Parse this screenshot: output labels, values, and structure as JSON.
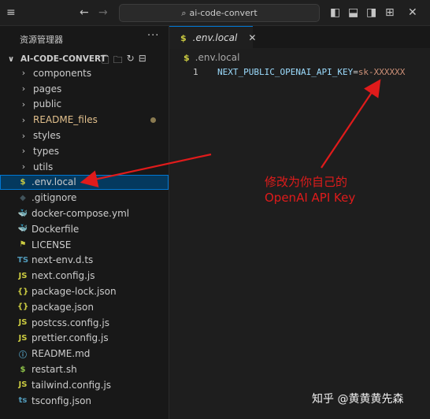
{
  "titlebar": {
    "search_text": "ai-code-convert",
    "back_icon": "arrow-left",
    "forward_icon": "arrow-right"
  },
  "explorer": {
    "header": "资源管理器",
    "more": "···",
    "root": "AI-CODE-CONVERT",
    "items": [
      {
        "label": "components",
        "type": "folder"
      },
      {
        "label": "pages",
        "type": "folder"
      },
      {
        "label": "public",
        "type": "folder"
      },
      {
        "label": "README_files",
        "type": "folder",
        "modified": true
      },
      {
        "label": "styles",
        "type": "folder"
      },
      {
        "label": "types",
        "type": "folder"
      },
      {
        "label": "utils",
        "type": "folder"
      },
      {
        "label": ".env.local",
        "type": "file",
        "icon": "$",
        "icon_color": "#cbcb41",
        "selected": true
      },
      {
        "label": ".gitignore",
        "type": "file",
        "icon": "◆",
        "icon_color": "#41535b"
      },
      {
        "label": "docker-compose.yml",
        "type": "file",
        "icon": "🐳",
        "icon_color": "#e06c75"
      },
      {
        "label": "Dockerfile",
        "type": "file",
        "icon": "🐳",
        "icon_color": "#519aba"
      },
      {
        "label": "LICENSE",
        "type": "file",
        "icon": "⚑",
        "icon_color": "#cbcb41"
      },
      {
        "label": "next-env.d.ts",
        "type": "file",
        "icon": "TS",
        "icon_color": "#519aba"
      },
      {
        "label": "next.config.js",
        "type": "file",
        "icon": "JS",
        "icon_color": "#cbcb41"
      },
      {
        "label": "package-lock.json",
        "type": "file",
        "icon": "{}",
        "icon_color": "#cbcb41"
      },
      {
        "label": "package.json",
        "type": "file",
        "icon": "{}",
        "icon_color": "#cbcb41"
      },
      {
        "label": "postcss.config.js",
        "type": "file",
        "icon": "JS",
        "icon_color": "#cbcb41"
      },
      {
        "label": "prettier.config.js",
        "type": "file",
        "icon": "JS",
        "icon_color": "#cbcb41"
      },
      {
        "label": "README.md",
        "type": "file",
        "icon": "ⓘ",
        "icon_color": "#519aba"
      },
      {
        "label": "restart.sh",
        "type": "file",
        "icon": "$",
        "icon_color": "#8dc149"
      },
      {
        "label": "tailwind.config.js",
        "type": "file",
        "icon": "JS",
        "icon_color": "#cbcb41"
      },
      {
        "label": "tsconfig.json",
        "type": "file",
        "icon": "ts",
        "icon_color": "#519aba"
      }
    ]
  },
  "editor": {
    "tab_label": ".env.local",
    "tab_icon": "$",
    "breadcrumb": ".env.local",
    "line_number": "1",
    "code_key": "NEXT_PUBLIC_OPENAI_API_KEY",
    "code_eq": "=",
    "code_value": "sk-XXXXXX"
  },
  "annotation": {
    "line1": "修改为你自己的",
    "line2": "OpenAI API Key",
    "color": "#e01b1b"
  },
  "watermark": "知乎 @黄黄黄先森"
}
